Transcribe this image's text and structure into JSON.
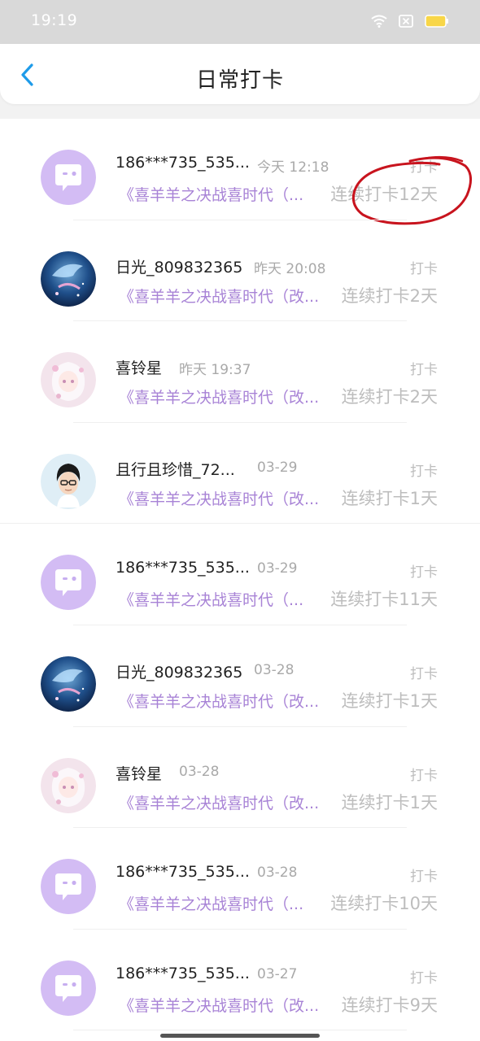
{
  "status_bar": {
    "time": "19:19"
  },
  "header": {
    "title": "日常打卡"
  },
  "items": [
    {
      "name": "186***735_535...",
      "time": "今天 12:18",
      "tag": "打卡",
      "book": "《喜羊羊之决战喜时代（...",
      "streak": "连续打卡12天",
      "avatar": "chat-bubble"
    },
    {
      "name": "日光_809832365",
      "time": "昨天 20:08",
      "tag": "打卡",
      "book": "《喜羊羊之决战喜时代（改...",
      "streak": "连续打卡2天",
      "avatar": "whale-art"
    },
    {
      "name": "喜铃星",
      "time": "昨天 19:37",
      "tag": "打卡",
      "book": "《喜羊羊之决战喜时代（改...",
      "streak": "连续打卡2天",
      "avatar": "anime-girl"
    },
    {
      "name": "且行且珍惜_72...",
      "time": "03-29",
      "tag": "打卡",
      "book": "《喜羊羊之决战喜时代（改...",
      "streak": "连续打卡1天",
      "avatar": "glasses-boy"
    },
    {
      "name": "186***735_535...",
      "time": "03-29",
      "tag": "打卡",
      "book": "《喜羊羊之决战喜时代（...",
      "streak": "连续打卡11天",
      "avatar": "chat-bubble"
    },
    {
      "name": "日光_809832365",
      "time": "03-28",
      "tag": "打卡",
      "book": "《喜羊羊之决战喜时代（改...",
      "streak": "连续打卡1天",
      "avatar": "whale-art"
    },
    {
      "name": "喜铃星",
      "time": "03-28",
      "tag": "打卡",
      "book": "《喜羊羊之决战喜时代（改...",
      "streak": "连续打卡1天",
      "avatar": "anime-girl"
    },
    {
      "name": "186***735_535...",
      "time": "03-28",
      "tag": "打卡",
      "book": "《喜羊羊之决战喜时代（...",
      "streak": "连续打卡10天",
      "avatar": "chat-bubble"
    },
    {
      "name": "186***735_535...",
      "time": "03-27",
      "tag": "打卡",
      "book": "《喜羊羊之决战喜时代（改...",
      "streak": "连续打卡9天",
      "avatar": "chat-bubble"
    }
  ],
  "colors": {
    "accent": "#a883d6",
    "back": "#1e9be9",
    "annotation": "#c8141e"
  }
}
